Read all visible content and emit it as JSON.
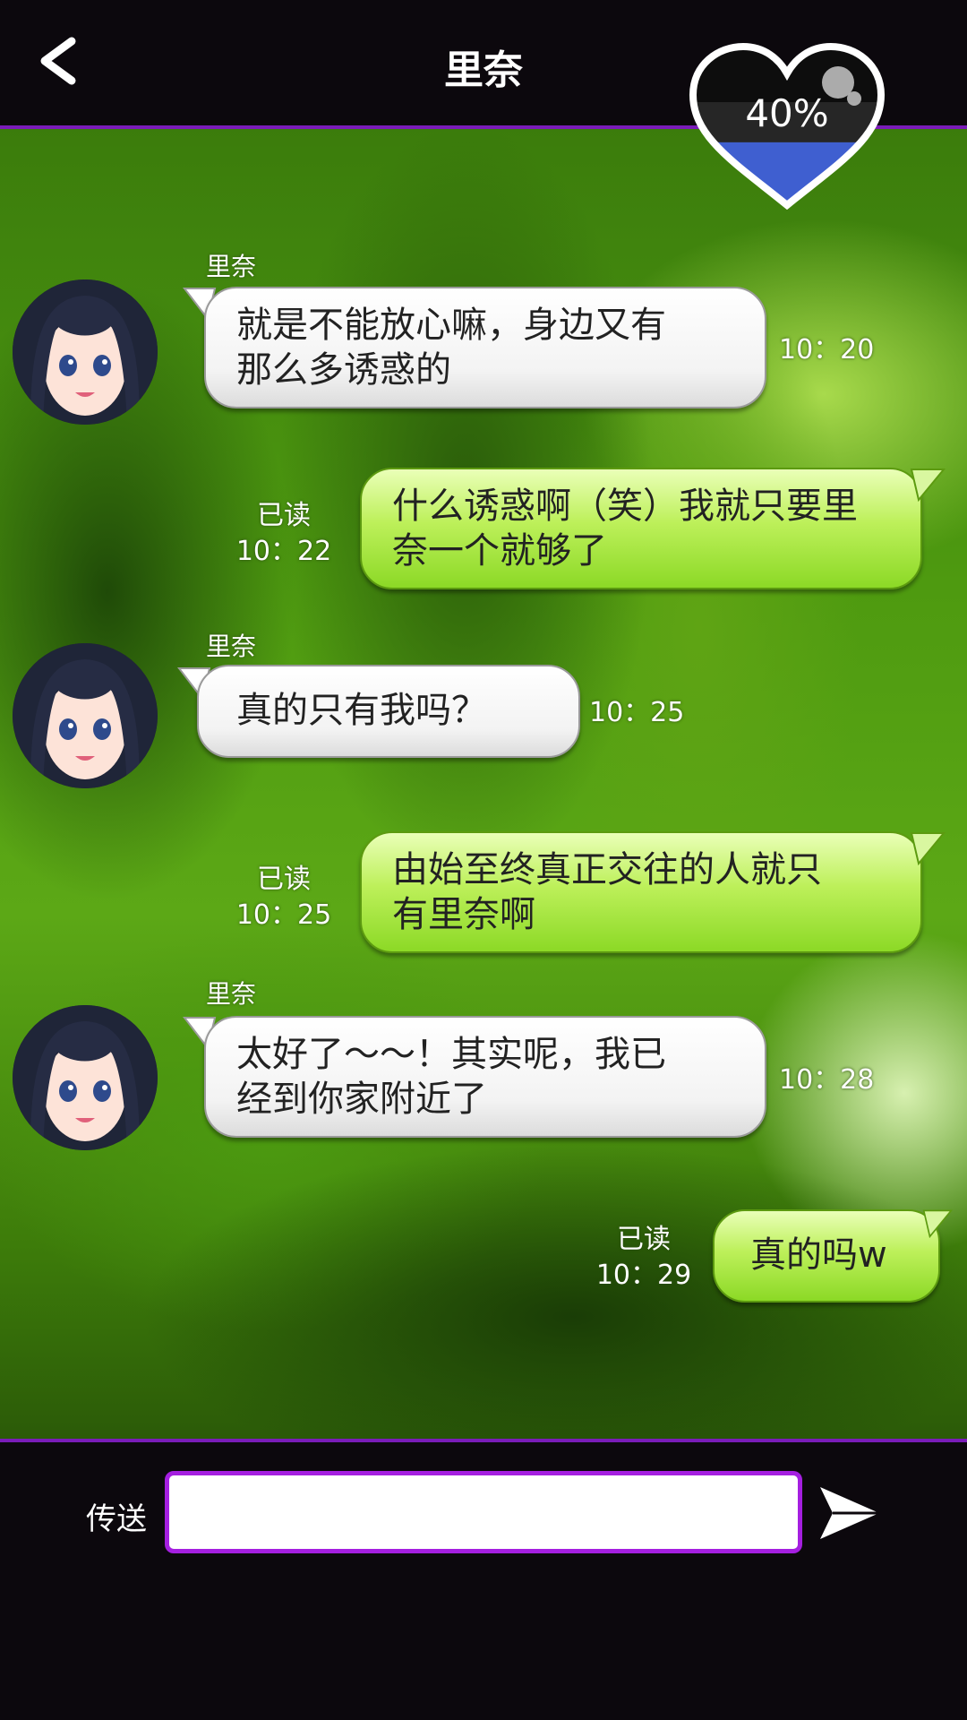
{
  "header": {
    "title": "里奈",
    "back_icon": "chevron-left-icon",
    "affection_percent": "40%",
    "affection_level": 0.4
  },
  "messages": [
    {
      "sender": "里奈",
      "direction": "incoming",
      "lines": [
        "就是不能放心嘛，身边又有",
        "那么多诱惑的"
      ],
      "time": "10：20"
    },
    {
      "direction": "outgoing",
      "status": "已读",
      "lines": [
        "什么诱惑啊（笑）我就只要里",
        "奈一个就够了"
      ],
      "time": "10：22"
    },
    {
      "sender": "里奈",
      "direction": "incoming",
      "lines": [
        "真的只有我吗？"
      ],
      "time": "10：25"
    },
    {
      "direction": "outgoing",
      "status": "已读",
      "lines": [
        "由始至终真正交往的人就只",
        "有里奈啊"
      ],
      "time": "10：25"
    },
    {
      "sender": "里奈",
      "direction": "incoming",
      "lines": [
        "太好了～～！其实呢，我已",
        "经到你家附近了"
      ],
      "time": "10：28"
    },
    {
      "direction": "outgoing",
      "status": "已读",
      "lines": [
        "真的吗w"
      ],
      "time": "10：29"
    }
  ],
  "composer": {
    "send_label": "传送",
    "input_value": "",
    "send_icon": "send-arrow-icon"
  },
  "colors": {
    "accent": "#a51fe0",
    "incoming_bubble": "#ffffff",
    "outgoing_bubble": "#a8e63c",
    "affection_fill": "#3f5fd0"
  }
}
